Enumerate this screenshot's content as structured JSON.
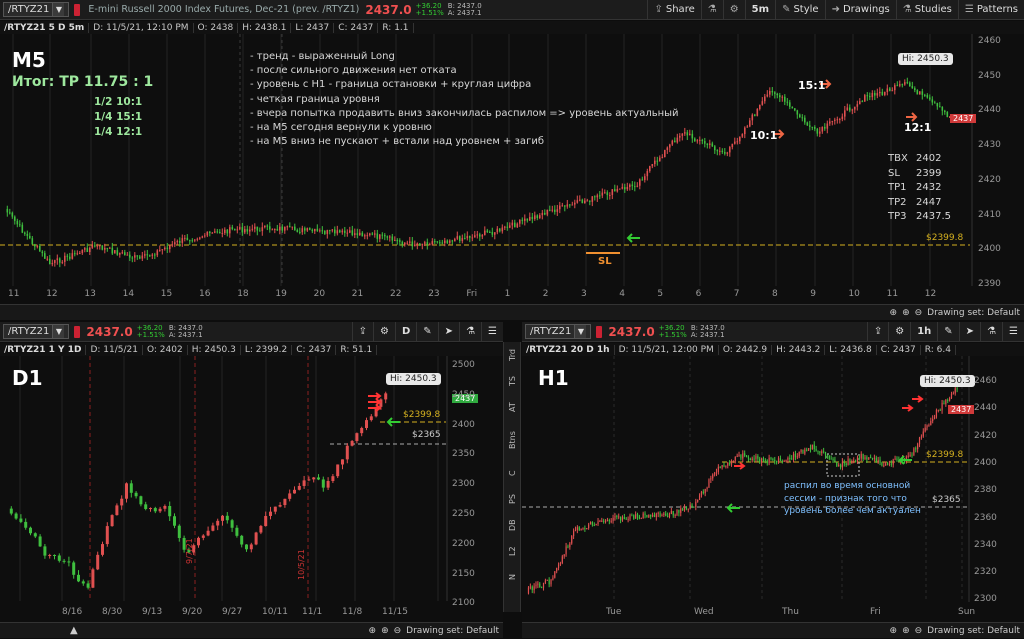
{
  "colors": {
    "up": "#3fbf3f",
    "down": "#e05050",
    "level": "#d4b020",
    "bg": "#0e0e0e"
  },
  "m5": {
    "symbol": "/RTYZ21",
    "description": "E-mini Russell 2000 Index Futures, Dec-21 (prev. /RTYZ1)",
    "price": "2437.0",
    "change": "+36.20",
    "change_pct": "+1.51%",
    "bid": "B: 2437.0",
    "ask": "A: 2437.1",
    "buttons": {
      "share": "Share",
      "timeframe": "5m",
      "style": "Style",
      "drawings": "Drawings",
      "studies": "Studies",
      "patterns": "Patterns"
    },
    "info": {
      "title": "/RTYZ21 5 D 5m",
      "date": "D: 11/5/21, 12:10 PM",
      "open": "O: 2438",
      "high": "H: 2438.1",
      "low": "L: 2437",
      "close": "C: 2437",
      "range": "R: 1.1"
    },
    "label": "M5",
    "result": "Итог: TP  11.75 : 1",
    "splits": [
      "1/2 10:1",
      "1/4 15:1",
      "1/4 12:1"
    ],
    "notes": [
      "- тренд - выраженный Long",
      "- после сильного движения нет отката",
      "- уровень с H1 - граница остановки + круглая цифра",
      "- четкая граница уровня",
      "- вчера попытка продавить вниз закончилась распилом => уровень актуальный",
      "- на M5 сегодня вернули к уровню",
      "- на M5 вниз не пускают + встали над уровнем + загиб"
    ],
    "trade": [
      {
        "k": "TBX",
        "v": "2402"
      },
      {
        "k": "SL",
        "v": "2399"
      },
      {
        "k": "TP1",
        "v": "2432"
      },
      {
        "k": "TP2",
        "v": "2447"
      },
      {
        "k": "TP3",
        "v": "2437.5"
      }
    ],
    "ratios": {
      "r10": "10:1",
      "r15": "15:1",
      "r12": "12:1"
    },
    "sl_label": "SL",
    "hi": "Hi: 2450.3",
    "level": "$2399.8",
    "last": "2437",
    "yticks": [
      "2460",
      "2450",
      "2440",
      "2430",
      "2420",
      "2410",
      "2400",
      "2390"
    ],
    "xticks": [
      "11",
      "12",
      "13",
      "14",
      "15",
      "16",
      "18",
      "19",
      "20",
      "21",
      "22",
      "23",
      "Fri",
      "1",
      "2",
      "3",
      "4",
      "5",
      "6",
      "7",
      "8",
      "9",
      "10",
      "11",
      "12"
    ],
    "drawing_set": "Drawing set: Default"
  },
  "d1": {
    "symbol": "/RTYZ21",
    "price": "2437.0",
    "change": "+36.20",
    "change_pct": "+1.51%",
    "bid": "B: 2437.0",
    "ask": "A: 2437.1",
    "tf": "D",
    "info": {
      "title": "/RTYZ21 1 Y 1D",
      "date": "D: 11/5/21",
      "open": "O: 2402",
      "high": "H: 2450.3",
      "low": "L: 2399.2",
      "close": "C: 2437",
      "range": "R: 51.1"
    },
    "label": "D1",
    "hi": "Hi: 2450.3",
    "level": "$2399.8",
    "level2": "$2365",
    "last": "2437",
    "yticks": [
      "2500",
      "2450",
      "2400",
      "2350",
      "2300",
      "2250",
      "2200",
      "2150",
      "2100"
    ],
    "xticks": [
      "8/16",
      "8/30",
      "9/13",
      "9/20",
      "9/27",
      "10/11",
      "11/1",
      "11/8",
      "11/15"
    ],
    "vlabels": [
      "9/7/21",
      "10/5/21"
    ],
    "drawing_set": "Drawing set: Default"
  },
  "h1": {
    "symbol": "/RTYZ21",
    "price": "2437.0",
    "change": "+36.20",
    "change_pct": "+1.51%",
    "bid": "B: 2437.0",
    "ask": "A: 2437.1",
    "tf": "1h",
    "info": {
      "title": "/RTYZ21 20 D 1h",
      "date": "D: 11/5/21, 12:00 PM",
      "open": "O: 2442.9",
      "high": "H: 2443.2",
      "low": "L: 2436.8",
      "close": "C: 2437",
      "range": "R: 6.4"
    },
    "label": "H1",
    "hi": "Hi: 2450.3",
    "level": "$2399.8",
    "level2": "$2365",
    "last": "2437",
    "note": [
      "распил во время основной",
      "сессии - признак того что",
      "уровень более чем актуален"
    ],
    "yticks": [
      "2460",
      "2440",
      "2420",
      "2400",
      "2380",
      "2360",
      "2340",
      "2320",
      "2300"
    ],
    "xticks": [
      "Tue",
      "Wed",
      "Thu",
      "Fri",
      "Sun"
    ],
    "drawing_set": "Drawing set: Default"
  },
  "sidebar": [
    "Trd",
    "TS",
    "AT",
    "Btns",
    "C",
    "PS",
    "DB",
    "L2",
    "N"
  ]
}
